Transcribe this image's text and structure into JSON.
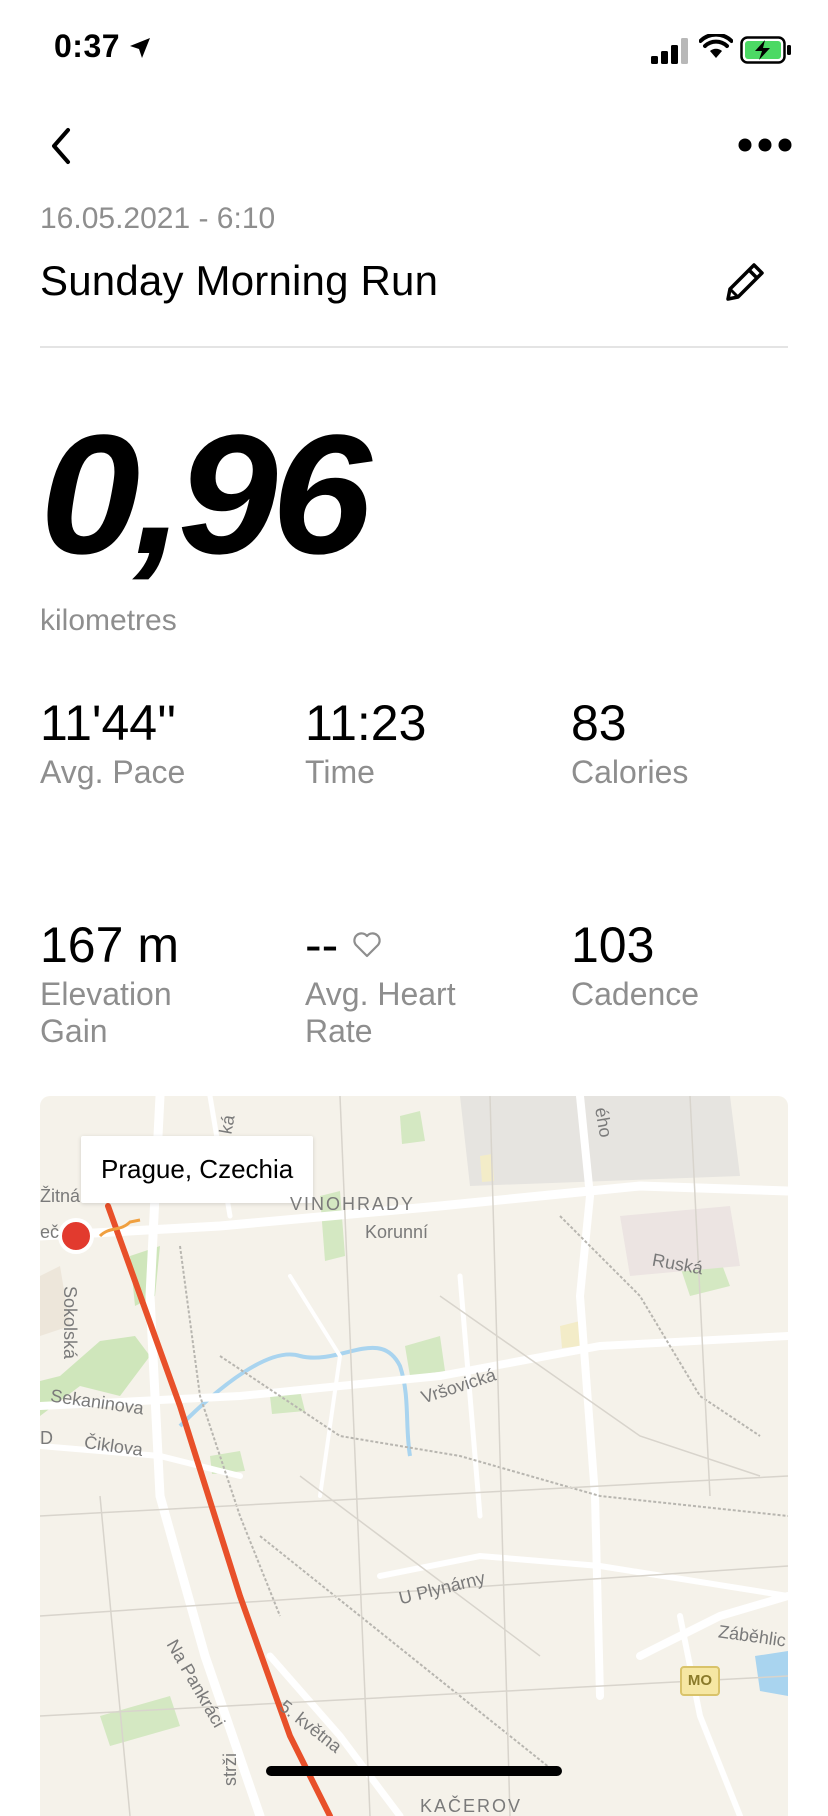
{
  "status_bar": {
    "time": "0:37",
    "icons": [
      "location-arrow-icon",
      "cellular-signal-icon",
      "wifi-icon",
      "battery-charging-icon"
    ],
    "battery_color": "#4cd964"
  },
  "nav": {
    "back_icon": "chevron-left-icon",
    "more_icon": "ellipsis-icon"
  },
  "activity": {
    "date": "16.05.2021 - 6:10",
    "title": "Sunday Morning Run",
    "edit_icon": "pencil-icon",
    "distance": "0,96",
    "distance_unit": "kilometres"
  },
  "stats": [
    {
      "value": "11'44''",
      "label": "Avg. Pace"
    },
    {
      "value": "11:23",
      "label": "Time"
    },
    {
      "value": "83",
      "label": "Calories"
    },
    {
      "value": "167 m",
      "label": "Elevation Gain"
    },
    {
      "value": "--",
      "label": "Avg. Heart Rate",
      "icon": "heart-outline-icon"
    },
    {
      "value": "103",
      "label": "Cadence"
    }
  ],
  "map": {
    "location": "Prague, Czechia",
    "route_color": "#e8502a",
    "start_marker_color": "#e23a2e",
    "labels": {
      "vinohrady": "VINOHRADY",
      "korunni": "Korunní",
      "ruska": "Ruská",
      "sokolska": "Sokolská",
      "sekaninova": "Sekaninova",
      "ciklova": "Čiklova",
      "vrsovicka": "Vršovická",
      "u_plynarny": "U Plynárny",
      "na_pankraci": "Na Pankráci",
      "pet_kvetna": "5. května",
      "zabehlice": "Záběhlic",
      "kacerov": "KAČEROV",
      "zitna": "Žitná",
      "stri": "strži",
      "ec": "eč",
      "d": "D",
      "ka": "ká",
      "eho": "ého"
    },
    "badge": "MO"
  }
}
